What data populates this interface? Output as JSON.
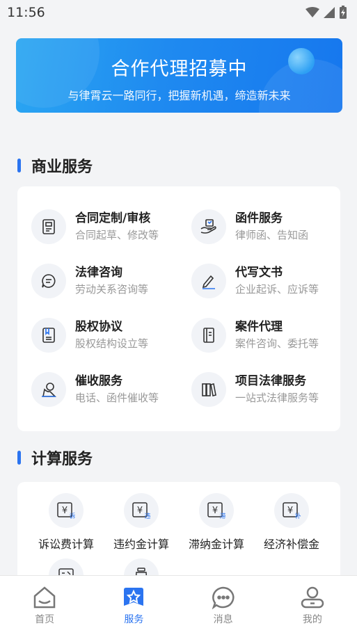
{
  "status": {
    "time": "11:56"
  },
  "banner": {
    "title": "合作代理招募中",
    "subtitle": "与律霄云一路同行，把握新机遇，缔造新未来"
  },
  "business": {
    "title": "商业服务",
    "items": [
      {
        "title": "合同定制/审核",
        "desc": "合同起草、修改等",
        "icon": "contract-icon"
      },
      {
        "title": "函件服务",
        "desc": "律师函、告知函",
        "icon": "letter-hand-icon"
      },
      {
        "title": "法律咨询",
        "desc": "劳动关系咨询等",
        "icon": "chat-bubble-icon"
      },
      {
        "title": "代写文书",
        "desc": "企业起诉、应诉等",
        "icon": "pen-icon"
      },
      {
        "title": "股权协议",
        "desc": "股权结构设立等",
        "icon": "bookmark-doc-icon"
      },
      {
        "title": "案件代理",
        "desc": "案件咨询、委托等",
        "icon": "case-folder-icon"
      },
      {
        "title": "催收服务",
        "desc": "电话、函件催收等",
        "icon": "collector-icon"
      },
      {
        "title": "项目法律服务",
        "desc": "一站式法律服务等",
        "icon": "books-icon"
      }
    ]
  },
  "calculation": {
    "title": "计算服务",
    "items": [
      {
        "label": "诉讼费计算",
        "badge": "诉"
      },
      {
        "label": "违约金计算",
        "badge": "违"
      },
      {
        "label": "滞纳金计算",
        "badge": "滞"
      },
      {
        "label": "经济补偿金",
        "badge": "补"
      }
    ]
  },
  "tabs": [
    {
      "label": "首页",
      "icon": "home-icon"
    },
    {
      "label": "服务",
      "icon": "service-star-icon"
    },
    {
      "label": "消息",
      "icon": "message-icon"
    },
    {
      "label": "我的",
      "icon": "profile-icon"
    }
  ],
  "colors": {
    "accent": "#2b74f0",
    "banner_start": "#2aa6f2",
    "banner_end": "#1677ee"
  }
}
